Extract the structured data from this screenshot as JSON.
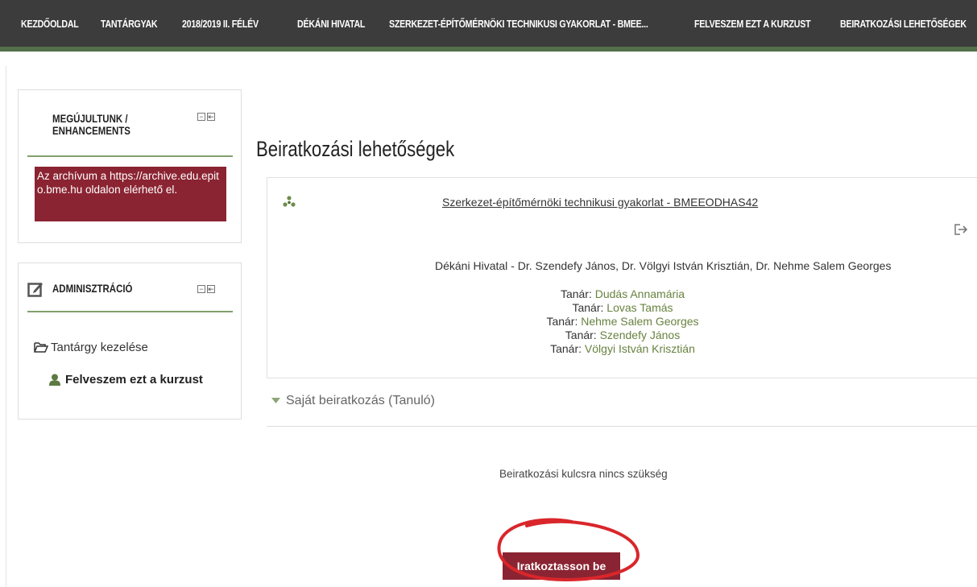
{
  "navbar": {
    "items": [
      "KEZDŐOLDAL",
      "TANTÁRGYAK",
      "2018/2019 II. FÉLÉV",
      "DÉKÁNI HIVATAL",
      "SZERKEZET-ÉPÍTŐMÉRNÖKI TECHNIKUSI GYAKORLAT - BMEE...",
      "FELVESZEM EZT A KURZUST",
      "BEIRATKOZÁSI LEHETŐSÉGEK"
    ]
  },
  "sidebar": {
    "enhancements": {
      "title_line1": "MEGÚJULTUNK /",
      "title_line2": "ENHANCEMENTS",
      "alert_text": "Az archívum a https://archive.edu.epito.bme.hu oldalon elérhető el."
    },
    "admin": {
      "title": "ADMINISZTRÁCIÓ",
      "manage_course": "Tantárgy kezelése",
      "enrol_me": "Felveszem ezt a kurzust"
    }
  },
  "main": {
    "page_title": "Beiratkozási lehetőségek",
    "course": {
      "name": "Szerkezet-építőmérnöki technikusi gyakorlat - BMEEODHAS42",
      "category_line": "Dékáni Hivatal - Dr. Szendefy János, Dr. Völgyi István Krisztián, Dr. Nehme Salem Georges",
      "teacher_label": "Tanár:",
      "teachers": [
        "Dudás Annamária",
        "Lovas Tamás",
        "Nehme Salem Georges",
        "Szendefy János",
        "Völgyi István Krisztián"
      ]
    },
    "self_enrol_header": "Saját beiratkozás (Tanuló)",
    "no_key_text": "Beiratkozási kulcsra nincs szükség",
    "enrol_button": "Iratkoztasson be"
  },
  "colors": {
    "navbar_bg": "#3c3c3c",
    "navbar_accent": "#54704a",
    "brand_red": "#8b2432",
    "link_green": "#68823f",
    "annotation_red": "#d9262b"
  }
}
